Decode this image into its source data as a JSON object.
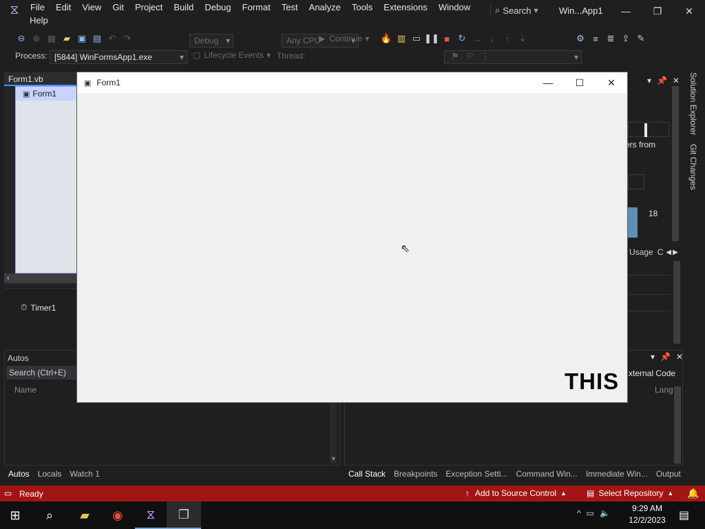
{
  "menu": {
    "items": [
      "File",
      "Edit",
      "View",
      "Git",
      "Project",
      "Build",
      "Debug",
      "Format",
      "Test",
      "Analyze",
      "Tools",
      "Extensions",
      "Window"
    ],
    "help": "Help",
    "search_label": "Search",
    "window_title": "Win...App1"
  },
  "toolbar": {
    "config": "Debug",
    "platform": "Any CPU",
    "continue_label": "Continue"
  },
  "process_bar": {
    "process_label": "Process:",
    "process_value": "[5844] WinFormsApp1.exe",
    "lifecycle_label": "Lifecycle Events",
    "thread_label": "Thread:"
  },
  "left_doc": {
    "tab_title": "Form1.vb",
    "form_node": "Form1",
    "timer_label": "Timer1"
  },
  "autos": {
    "title": "Autos",
    "search_placeholder": "Search (Ctrl+E)",
    "col_name": "Name",
    "tabs": [
      "Autos",
      "Locals",
      "Watch 1"
    ]
  },
  "right_panel": {
    "side_tabs": [
      "Solution Explorer",
      "Git Changes"
    ],
    "partial_text": "ers from",
    "number": "18",
    "usage_tab": "Usage",
    "c_tab": "C",
    "external_code": "External Code",
    "lang_col": "Lang"
  },
  "bottom_tabs": [
    "Call Stack",
    "Breakpoints",
    "Exception Setti...",
    "Command Win...",
    "Immediate Win...",
    "Output"
  ],
  "form1": {
    "title": "Form1",
    "overlay_text": "THIS"
  },
  "status": {
    "ready": "Ready",
    "source_control": "Add to Source Control",
    "repository": "Select Repository"
  },
  "taskbar": {
    "time": "9:29 AM",
    "date": "12/2/2023"
  },
  "colors": {
    "status_bar": "#a31515",
    "vs_purple": "#c9a2ff",
    "form_bg": "#f0f0f0"
  }
}
